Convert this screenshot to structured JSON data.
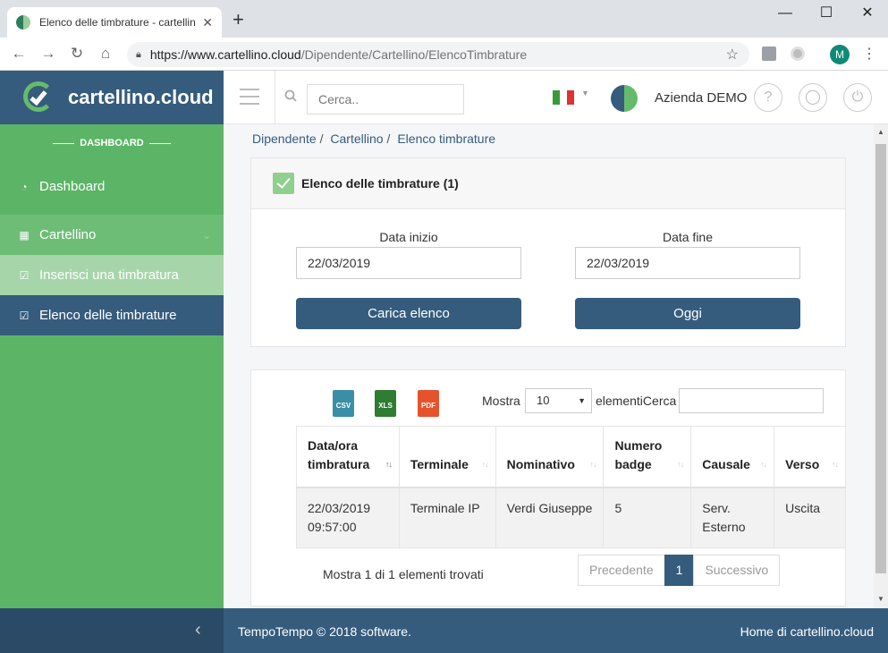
{
  "browser": {
    "tab_title": "Elenco delle timbrature - cartellin",
    "tab_close": "✕",
    "new_tab": "+",
    "url_host": "https://www.cartellino.cloud",
    "url_path": "/Dipendente/Cartellino/ElencoTimbrature",
    "profile_initial": "M",
    "controls": {
      "minimize": "—",
      "maximize": "☐",
      "close": "✕"
    },
    "nav": {
      "back": "←",
      "forward": "→",
      "reload": "↻",
      "home": "⌂"
    },
    "icons": [
      "lock-icon",
      "star-icon",
      "drive-extension-icon",
      "circle-extension-icon",
      "kebab-menu-icon"
    ]
  },
  "header": {
    "brand": "cartellino.cloud",
    "search_placeholder": "Cerca..",
    "language_flag": "it",
    "company": "Azienda DEMO",
    "buttons": {
      "help": "?",
      "user": "◯",
      "logout": "⏻"
    },
    "colors": {
      "brand_bg": "#355c7d",
      "accent": "#5cb466"
    }
  },
  "sidebar": {
    "section": "DASHBOARD",
    "items": [
      {
        "label": "Dashboard",
        "icon": "dashboard-icon"
      },
      {
        "label": "Cartellino",
        "icon": "calendar-check-icon"
      },
      {
        "label": "Inserisci una timbratura",
        "icon": "check-square-icon"
      },
      {
        "label": "Elenco delle timbrature",
        "icon": "check-square-icon"
      }
    ],
    "collapse_icon": "‹"
  },
  "breadcrumb": [
    "Dipendente",
    "Cartellino",
    "Elenco timbrature"
  ],
  "filter": {
    "title": "Elenco delle timbrature (1)",
    "start_label": "Data inizio",
    "start_value": "22/03/2019",
    "end_label": "Data fine",
    "end_value": "22/03/2019",
    "load_button": "Carica elenco",
    "today_button": "Oggi"
  },
  "table": {
    "exports": [
      "CSV",
      "XLS",
      "PDF"
    ],
    "length_label": "Mostra",
    "length_value": "10",
    "length_suffix": "elementiCerca",
    "columns": [
      {
        "line1": "Data/ora",
        "line2": "timbratura",
        "sort": "↑↓"
      },
      {
        "line1": "",
        "line2": "Terminale",
        "sort": "↑↓"
      },
      {
        "line1": "",
        "line2": "Nominativo",
        "sort": "↑↓"
      },
      {
        "line1": "Numero",
        "line2": "badge",
        "sort": "↑↓"
      },
      {
        "line1": "",
        "line2": "Causale",
        "sort": "↑↓"
      },
      {
        "line1": "",
        "line2": "Verso",
        "sort": "↑↓"
      }
    ],
    "rows": [
      {
        "datetime_date": "22/03/2019",
        "datetime_time": "09:57:00",
        "terminal": "Terminale IP",
        "name": "Verdi Giuseppe",
        "badge": "5",
        "causale_1": "Serv.",
        "causale_2": "Esterno",
        "verso": "Uscita"
      }
    ],
    "info": "Mostra 1 di 1 elementi trovati",
    "pager": {
      "prev": "Precedente",
      "current": "1",
      "next": "Successivo"
    }
  },
  "footer": {
    "copyright": "TempoTempo © 2018 software.",
    "home_link": "Home di cartellino.cloud"
  }
}
